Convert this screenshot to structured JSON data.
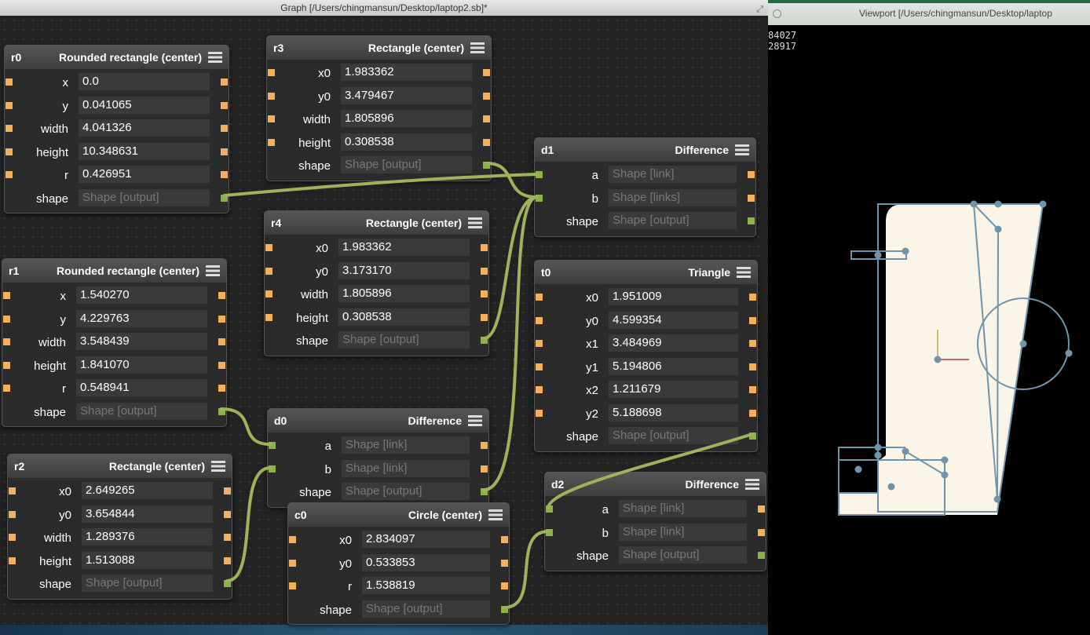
{
  "graph": {
    "title": "Graph [/Users/chingmansun/Desktop/laptop2.sb]*"
  },
  "viewport": {
    "title": "Viewport [/Users/chingmansun/Desktop/laptop",
    "coord_x": "84027",
    "coord_y": "28917"
  },
  "colors": {
    "port": "#f2b15a",
    "shape_port": "#8bb34a",
    "wire": "#9fb35a",
    "shape_fill": "#fbf5e8",
    "outline": "#6f94ab"
  },
  "nodes": {
    "r0": {
      "name": "r0",
      "type": "Rounded rectangle (center)",
      "fields": [
        {
          "label": "x",
          "value": "0.0"
        },
        {
          "label": "y",
          "value": "0.041065"
        },
        {
          "label": "width",
          "value": "4.041326"
        },
        {
          "label": "height",
          "value": "10.348631"
        },
        {
          "label": "r",
          "value": "0.426951"
        },
        {
          "label": "shape",
          "value": "Shape [output]"
        }
      ]
    },
    "r3": {
      "name": "r3",
      "type": "Rectangle (center)",
      "fields": [
        {
          "label": "x0",
          "value": "1.983362"
        },
        {
          "label": "y0",
          "value": "3.479467"
        },
        {
          "label": "width",
          "value": "1.805896"
        },
        {
          "label": "height",
          "value": "0.308538"
        },
        {
          "label": "shape",
          "value": "Shape [output]"
        }
      ]
    },
    "r4": {
      "name": "r4",
      "type": "Rectangle (center)",
      "fields": [
        {
          "label": "x0",
          "value": "1.983362"
        },
        {
          "label": "y0",
          "value": "3.173170"
        },
        {
          "label": "width",
          "value": "1.805896"
        },
        {
          "label": "height",
          "value": "0.308538"
        },
        {
          "label": "shape",
          "value": "Shape [output]"
        }
      ]
    },
    "r1": {
      "name": "r1",
      "type": "Rounded rectangle (center)",
      "fields": [
        {
          "label": "x",
          "value": "1.540270"
        },
        {
          "label": "y",
          "value": "4.229763"
        },
        {
          "label": "width",
          "value": "3.548439"
        },
        {
          "label": "height",
          "value": "1.841070"
        },
        {
          "label": "r",
          "value": "0.548941"
        },
        {
          "label": "shape",
          "value": "Shape [output]"
        }
      ]
    },
    "r2": {
      "name": "r2",
      "type": "Rectangle (center)",
      "fields": [
        {
          "label": "x0",
          "value": "2.649265"
        },
        {
          "label": "y0",
          "value": "3.654844"
        },
        {
          "label": "width",
          "value": "1.289376"
        },
        {
          "label": "height",
          "value": "1.513088"
        },
        {
          "label": "shape",
          "value": "Shape [output]"
        }
      ]
    },
    "d0": {
      "name": "d0",
      "type": "Difference",
      "fields": [
        {
          "label": "a",
          "value": "Shape [link]"
        },
        {
          "label": "b",
          "value": "Shape [link]"
        },
        {
          "label": "shape",
          "value": "Shape [output]"
        }
      ]
    },
    "c0": {
      "name": "c0",
      "type": "Circle (center)",
      "fields": [
        {
          "label": "x0",
          "value": "2.834097"
        },
        {
          "label": "y0",
          "value": "0.533853"
        },
        {
          "label": "r",
          "value": "1.538819"
        },
        {
          "label": "shape",
          "value": "Shape [output]"
        }
      ]
    },
    "d1": {
      "name": "d1",
      "type": "Difference",
      "fields": [
        {
          "label": "a",
          "value": "Shape [link]"
        },
        {
          "label": "b",
          "value": "Shape [links]"
        },
        {
          "label": "shape",
          "value": "Shape [output]"
        }
      ]
    },
    "t0": {
      "name": "t0",
      "type": "Triangle",
      "fields": [
        {
          "label": "x0",
          "value": "1.951009"
        },
        {
          "label": "y0",
          "value": "4.599354"
        },
        {
          "label": "x1",
          "value": "3.484969"
        },
        {
          "label": "y1",
          "value": "5.194806"
        },
        {
          "label": "x2",
          "value": "1.211679"
        },
        {
          "label": "y2",
          "value": "5.188698"
        },
        {
          "label": "shape",
          "value": "Shape [output]"
        }
      ]
    },
    "d2": {
      "name": "d2",
      "type": "Difference",
      "fields": [
        {
          "label": "a",
          "value": "Shape [link]"
        },
        {
          "label": "b",
          "value": "Shape [link]"
        },
        {
          "label": "shape",
          "value": "Shape [output]"
        }
      ]
    }
  }
}
